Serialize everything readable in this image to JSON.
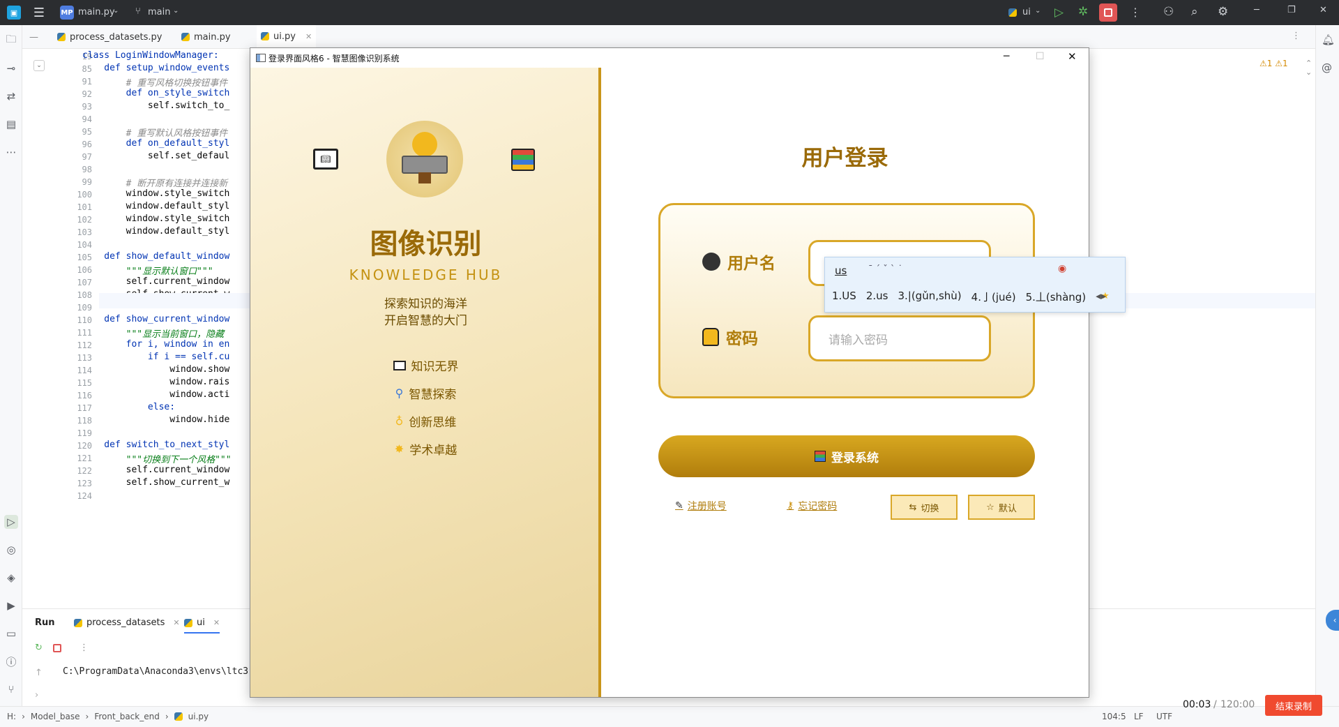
{
  "ide": {
    "project_badge": "MP",
    "project_name": "main.py",
    "branch": "main",
    "run_config": "ui",
    "tabs": [
      {
        "label": "process_datasets.py"
      },
      {
        "label": "main.py"
      },
      {
        "label": "ui.py"
      }
    ],
    "line_numbers": [
      "19",
      "85",
      "91",
      "92",
      "93",
      "94",
      "95",
      "96",
      "97",
      "98",
      "99",
      "100",
      "101",
      "102",
      "103",
      "104",
      "105",
      "106",
      "107",
      "108",
      "109",
      "110",
      "111",
      "112",
      "113",
      "114",
      "115",
      "116",
      "117",
      "118",
      "119",
      "120",
      "121",
      "122",
      "123",
      "124"
    ],
    "code_lines": [
      "class LoginWindowManager:",
      "    def setup_window_events",
      "        # 重写风格切换按钮事件",
      "        def on_style_switch",
      "            self.switch_to_",
      "",
      "        # 重写默认风格按钮事件",
      "        def on_default_styl",
      "            self.set_defaul",
      "",
      "        # 断开原有连接并连接新",
      "        window.style_switch",
      "        window.default_styl",
      "        window.style_switch",
      "        window.default_styl",
      "",
      "    def show_default_window",
      "        \"\"\"显示默认窗口\"\"\"",
      "        self.current_window",
      "        self.show_current_w",
      "",
      "    def show_current_window",
      "        \"\"\"显示当前窗口，隐藏",
      "        for i, window in en",
      "            if i == self.cu",
      "                window.show",
      "                window.rais",
      "                window.acti",
      "            else:",
      "                window.hide",
      "",
      "    def switch_to_next_styl",
      "        \"\"\"切换到下一个风格\"\"\"",
      "        self.current_window",
      "        self.show_current_w",
      ""
    ],
    "run_panel": {
      "title": "Run",
      "tabs": [
        "process_datasets",
        "ui"
      ],
      "console_line": "C:\\ProgramData\\Anaconda3\\envs\\ltc3"
    },
    "warnings": {
      "a": "1",
      "b": "1"
    },
    "statusbar": {
      "breadcrumbs": [
        "H:",
        "Model_base",
        "Front_back_end",
        "ui.py"
      ],
      "position": "104:5",
      "line_sep": "LF",
      "encoding": "UTF"
    }
  },
  "app": {
    "window_title": "登录界面风格6 - 智慧图像识别系统",
    "left": {
      "title": "图像识别",
      "subtitle": "KNOWLEDGE HUB",
      "slogan1": "探索知识的海洋",
      "slogan2": "开启智慧的大门",
      "features": [
        "知识无界",
        "智慧探索",
        "创新思维",
        "学术卓越"
      ]
    },
    "right": {
      "heading": "用户登录",
      "username_label": "用户名",
      "password_label": "密码",
      "password_placeholder": "请输入密码",
      "login_button": "登录系统",
      "register_link": "注册账号",
      "forgot_link": "忘记密码",
      "switch_button": "切换",
      "default_button": "默认"
    }
  },
  "ime": {
    "composition": "us",
    "candidates": [
      "1.US",
      "2.us",
      "3.|(gǔn,shù)",
      "4.亅(jué)",
      "5.丄(shàng)"
    ]
  },
  "recording": {
    "elapsed": "00:03",
    "total": "120:00",
    "stop_label": "结束录制"
  }
}
